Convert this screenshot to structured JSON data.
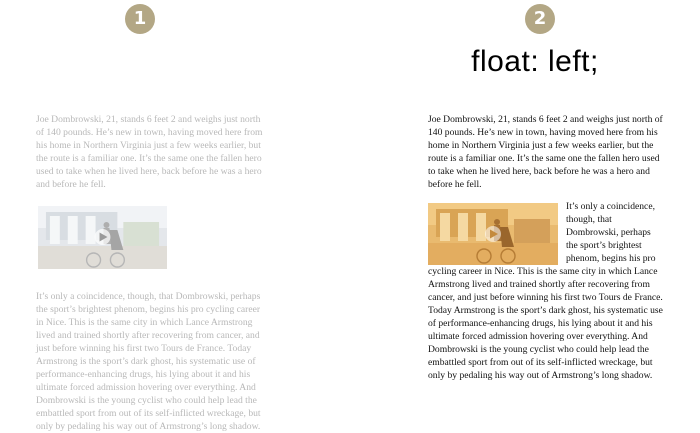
{
  "badges": {
    "left": "1",
    "right": "2"
  },
  "panel_right_title": "float: left;",
  "article": {
    "paragraph1": "Joe Dombrowski, 21, stands 6 feet 2 and weighs just north of 140 pounds. He’s new in town, having moved here from his home in Northern Virginia just a few weeks earlier, but the route is a familiar one. It’s the same one the fallen hero used to take when he lived here, back before he was a hero and before he fell.",
    "paragraph2": "It’s only a coincidence, though, that Dombrowski, perhaps the sport’s brightest phenom, begins his pro cycling career in Nice. This is the same city in which Lance Armstrong lived and trained shortly after recovering from cancer, and just before winning his first two Tours de France. Today Armstrong is the sport’s dark ghost, his systematic use of performance-enhancing drugs, his lying about it and his ultimate forced admission hovering over everything. And Dombrowski is the young cyclist who could help lead the embattled sport from out of its self-inflicted wreckage, but only by pedaling his way out of Armstrong’s long shadow."
  },
  "icons": {
    "video": "video-play-icon"
  },
  "colors": {
    "badge": "#b3a785",
    "faded_text": "#b8b8b8",
    "text": "#111111",
    "video_tint": "#efbf72"
  }
}
